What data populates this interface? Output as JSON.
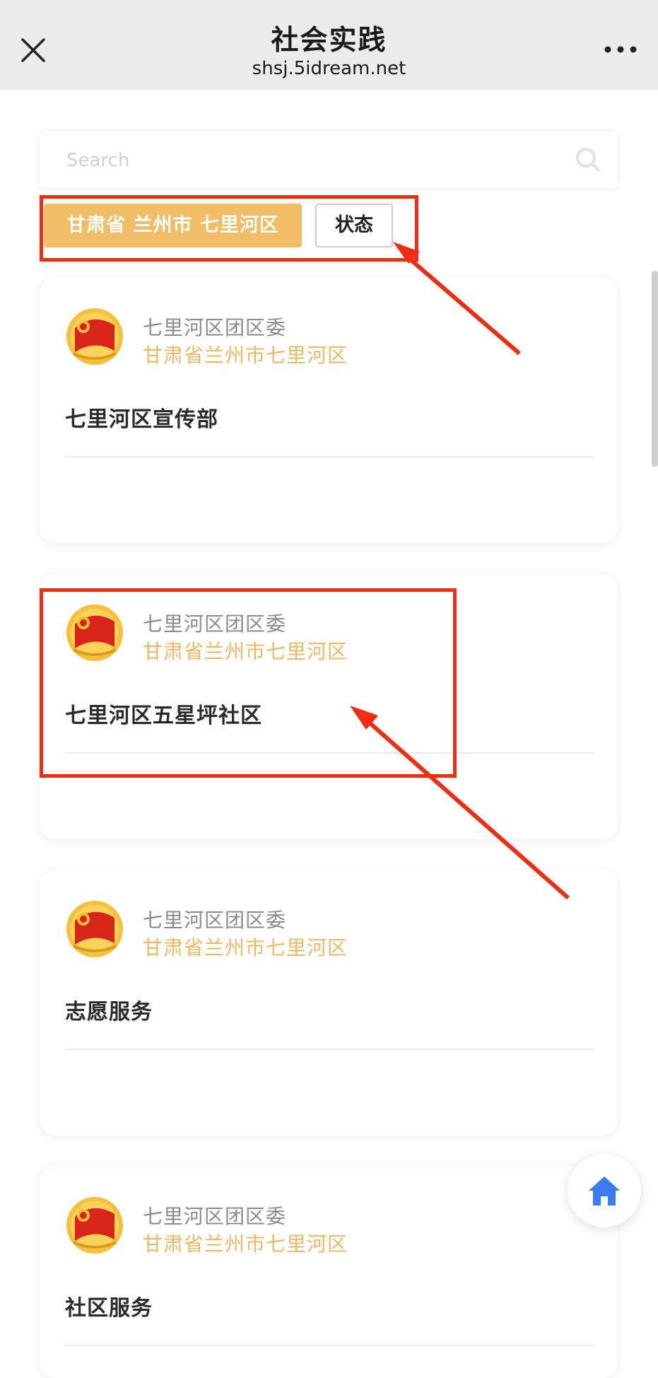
{
  "header": {
    "title": "社会实践",
    "url": "shsj.5idream.net"
  },
  "search": {
    "placeholder": "Search"
  },
  "filters": {
    "region": "甘肃省 兰州市 七里河区",
    "status": "状态"
  },
  "cards": [
    {
      "org": "七里河区团区委",
      "location": "甘肃省兰州市七里河区",
      "title": "七里河区宣传部"
    },
    {
      "org": "七里河区团区委",
      "location": "甘肃省兰州市七里河区",
      "title": "七里河区五星坪社区"
    },
    {
      "org": "七里河区团区委",
      "location": "甘肃省兰州市七里河区",
      "title": "志愿服务"
    },
    {
      "org": "七里河区团区委",
      "location": "甘肃省兰州市七里河区",
      "title": "社区服务"
    }
  ],
  "icons": {
    "close": "close-icon",
    "more": "more-icon",
    "search": "search-icon",
    "logo": "youth-league-emblem-icon",
    "home": "home-icon"
  },
  "colors": {
    "accent": "#f1bd66",
    "location_text": "#efb863",
    "annotation": "#f02c13",
    "home": "#3b7cf0"
  }
}
